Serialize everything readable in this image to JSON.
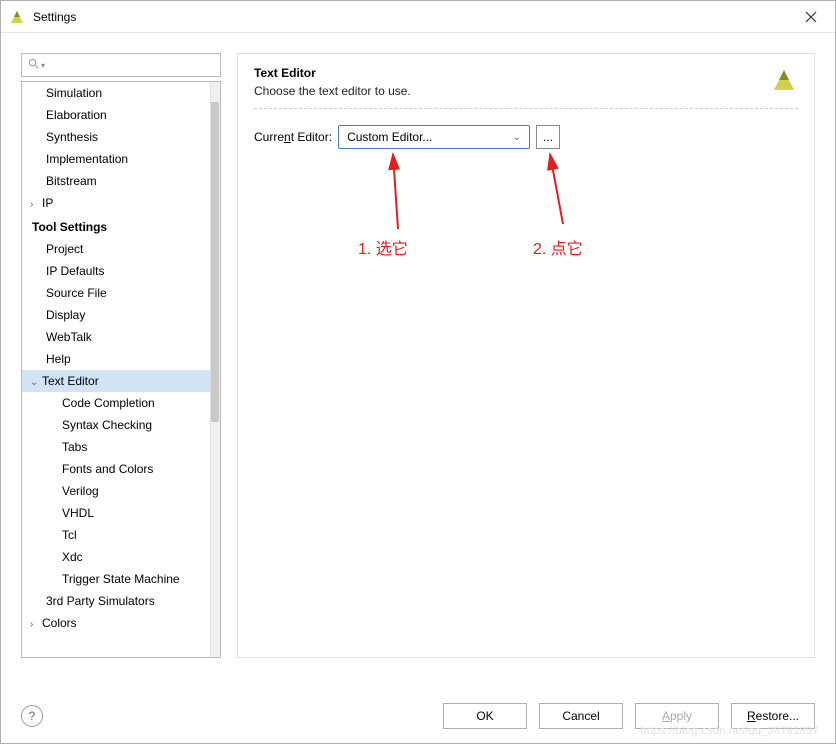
{
  "window": {
    "title": "Settings"
  },
  "search": {
    "placeholder": ""
  },
  "tree": {
    "section1": [
      {
        "label": "Simulation"
      },
      {
        "label": "Elaboration"
      },
      {
        "label": "Synthesis"
      },
      {
        "label": "Implementation"
      },
      {
        "label": "Bitstream"
      },
      {
        "label": "IP",
        "expandable": true
      }
    ],
    "section2_header": "Tool Settings",
    "section2": [
      {
        "label": "Project"
      },
      {
        "label": "IP Defaults"
      },
      {
        "label": "Source File"
      },
      {
        "label": "Display"
      },
      {
        "label": "WebTalk"
      },
      {
        "label": "Help"
      },
      {
        "label": "Text Editor",
        "expanded": true,
        "selected": true,
        "children": [
          {
            "label": "Code Completion"
          },
          {
            "label": "Syntax Checking"
          },
          {
            "label": "Tabs"
          },
          {
            "label": "Fonts and Colors"
          },
          {
            "label": "Verilog"
          },
          {
            "label": "VHDL"
          },
          {
            "label": "Tcl"
          },
          {
            "label": "Xdc"
          },
          {
            "label": "Trigger State Machine"
          }
        ]
      },
      {
        "label": "3rd Party Simulators"
      },
      {
        "label": "Colors",
        "expandable": true
      }
    ]
  },
  "panel": {
    "title": "Text Editor",
    "subtitle": "Choose the text editor to use.",
    "field_label_pre": "Curre",
    "field_label_u": "n",
    "field_label_post": "t Editor:",
    "select_value": "Custom Editor...",
    "browse_label": "..."
  },
  "annotations": {
    "a1": "1. 选它",
    "a2": "2. 点它"
  },
  "buttons": {
    "ok": "OK",
    "cancel": "Cancel",
    "apply_u": "A",
    "apply_post": "pply",
    "restore_u": "R",
    "restore_post": "estore..."
  },
  "watermark": "https://blog.csdn.net/qq_38791897"
}
